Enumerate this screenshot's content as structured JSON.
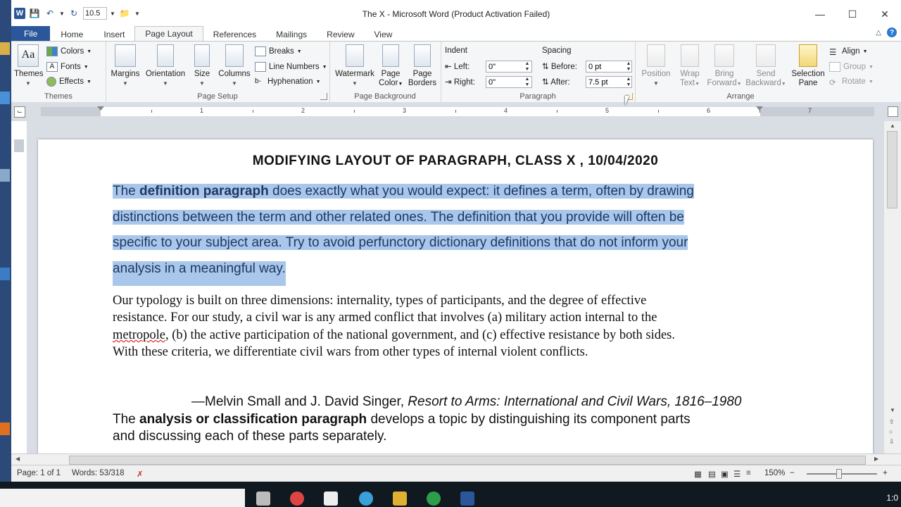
{
  "window": {
    "title": "The X  -  Microsoft Word (Product Activation Failed)",
    "font_size": "10.5",
    "minimize": "—",
    "maximize": "☐",
    "close": "✕"
  },
  "tabs": [
    "File",
    "Home",
    "Insert",
    "Page Layout",
    "References",
    "Mailings",
    "Review",
    "View"
  ],
  "active_tab": "Page Layout",
  "ribbon": {
    "themes": {
      "label": "Themes",
      "button": "Themes",
      "colors": "Colors",
      "fonts": "Fonts",
      "effects": "Effects"
    },
    "page_setup": {
      "label": "Page Setup",
      "margins": "Margins",
      "orientation": "Orientation",
      "size": "Size",
      "columns": "Columns",
      "breaks": "Breaks",
      "line_numbers": "Line Numbers",
      "hyphenation": "Hyphenation"
    },
    "page_background": {
      "label": "Page Background",
      "watermark": "Watermark",
      "page_color_1": "Page",
      "page_color_2": "Color",
      "page_borders_1": "Page",
      "page_borders_2": "Borders"
    },
    "paragraph": {
      "label": "Paragraph",
      "indent": "Indent",
      "left_label": "Left:",
      "left_value": "0\"",
      "right_label": "Right:",
      "right_value": "0\"",
      "spacing": "Spacing",
      "before_label": "Before:",
      "before_value": "0 pt",
      "after_label": "After:",
      "after_value": "7.5 pt"
    },
    "arrange": {
      "label": "Arrange",
      "position": "Position",
      "wrap_1": "Wrap",
      "wrap_2": "Text",
      "bring_1": "Bring",
      "bring_2": "Forward",
      "send_1": "Send",
      "send_2": "Backward",
      "selection_1": "Selection",
      "selection_2": "Pane",
      "align": "Align",
      "group": "Group",
      "rotate": "Rotate"
    }
  },
  "ruler_numbers": [
    "1",
    "2",
    "3",
    "4",
    "5",
    "6",
    "7"
  ],
  "document": {
    "title": "MODIFYING  LAYOUT OF PARAGRAPH, CLASS X , 10/04/2020",
    "para1": {
      "pre": "The ",
      "bold": "definition paragraph",
      "line1_rest": " does exactly what you would expect: it defines a term, often by drawing",
      "line2": "distinctions between the term and other related ones. The definition that you provide will often be",
      "line3": "specific to your subject area. Try to avoid perfunctory dictionary definitions that do not inform your",
      "line4": "analysis in a meaningful way. "
    },
    "para2": {
      "line1": "Our typology is built on three dimensions: internality, types of participants, and the degree of effective",
      "line2": "resistance. For our study, a civil war is any armed conflict that involves (a) military action internal to the",
      "line3_word": "metropole",
      "line3_rest": ", (b) the active participation of the national government, and (c) effective resistance by both sides.",
      "line4": "With these criteria, we differentiate civil wars from other types of internal violent conflicts."
    },
    "citation": {
      "author": "—Melvin Small and J. David Singer, ",
      "work": "Resort to Arms: International and Civil Wars, 1816–1980"
    },
    "para3": {
      "pre": "The ",
      "bold": "analysis or classification paragraph",
      "line1_rest": " develops a topic by distinguishing its component parts",
      "line2": "and discussing each of these parts separately."
    }
  },
  "status": {
    "page": "Page: 1 of 1",
    "words": "Words: 53/318",
    "zoom": "150%",
    "zoom_minus": "−",
    "zoom_plus": "+"
  },
  "taskbar": {
    "time": "1:0"
  }
}
